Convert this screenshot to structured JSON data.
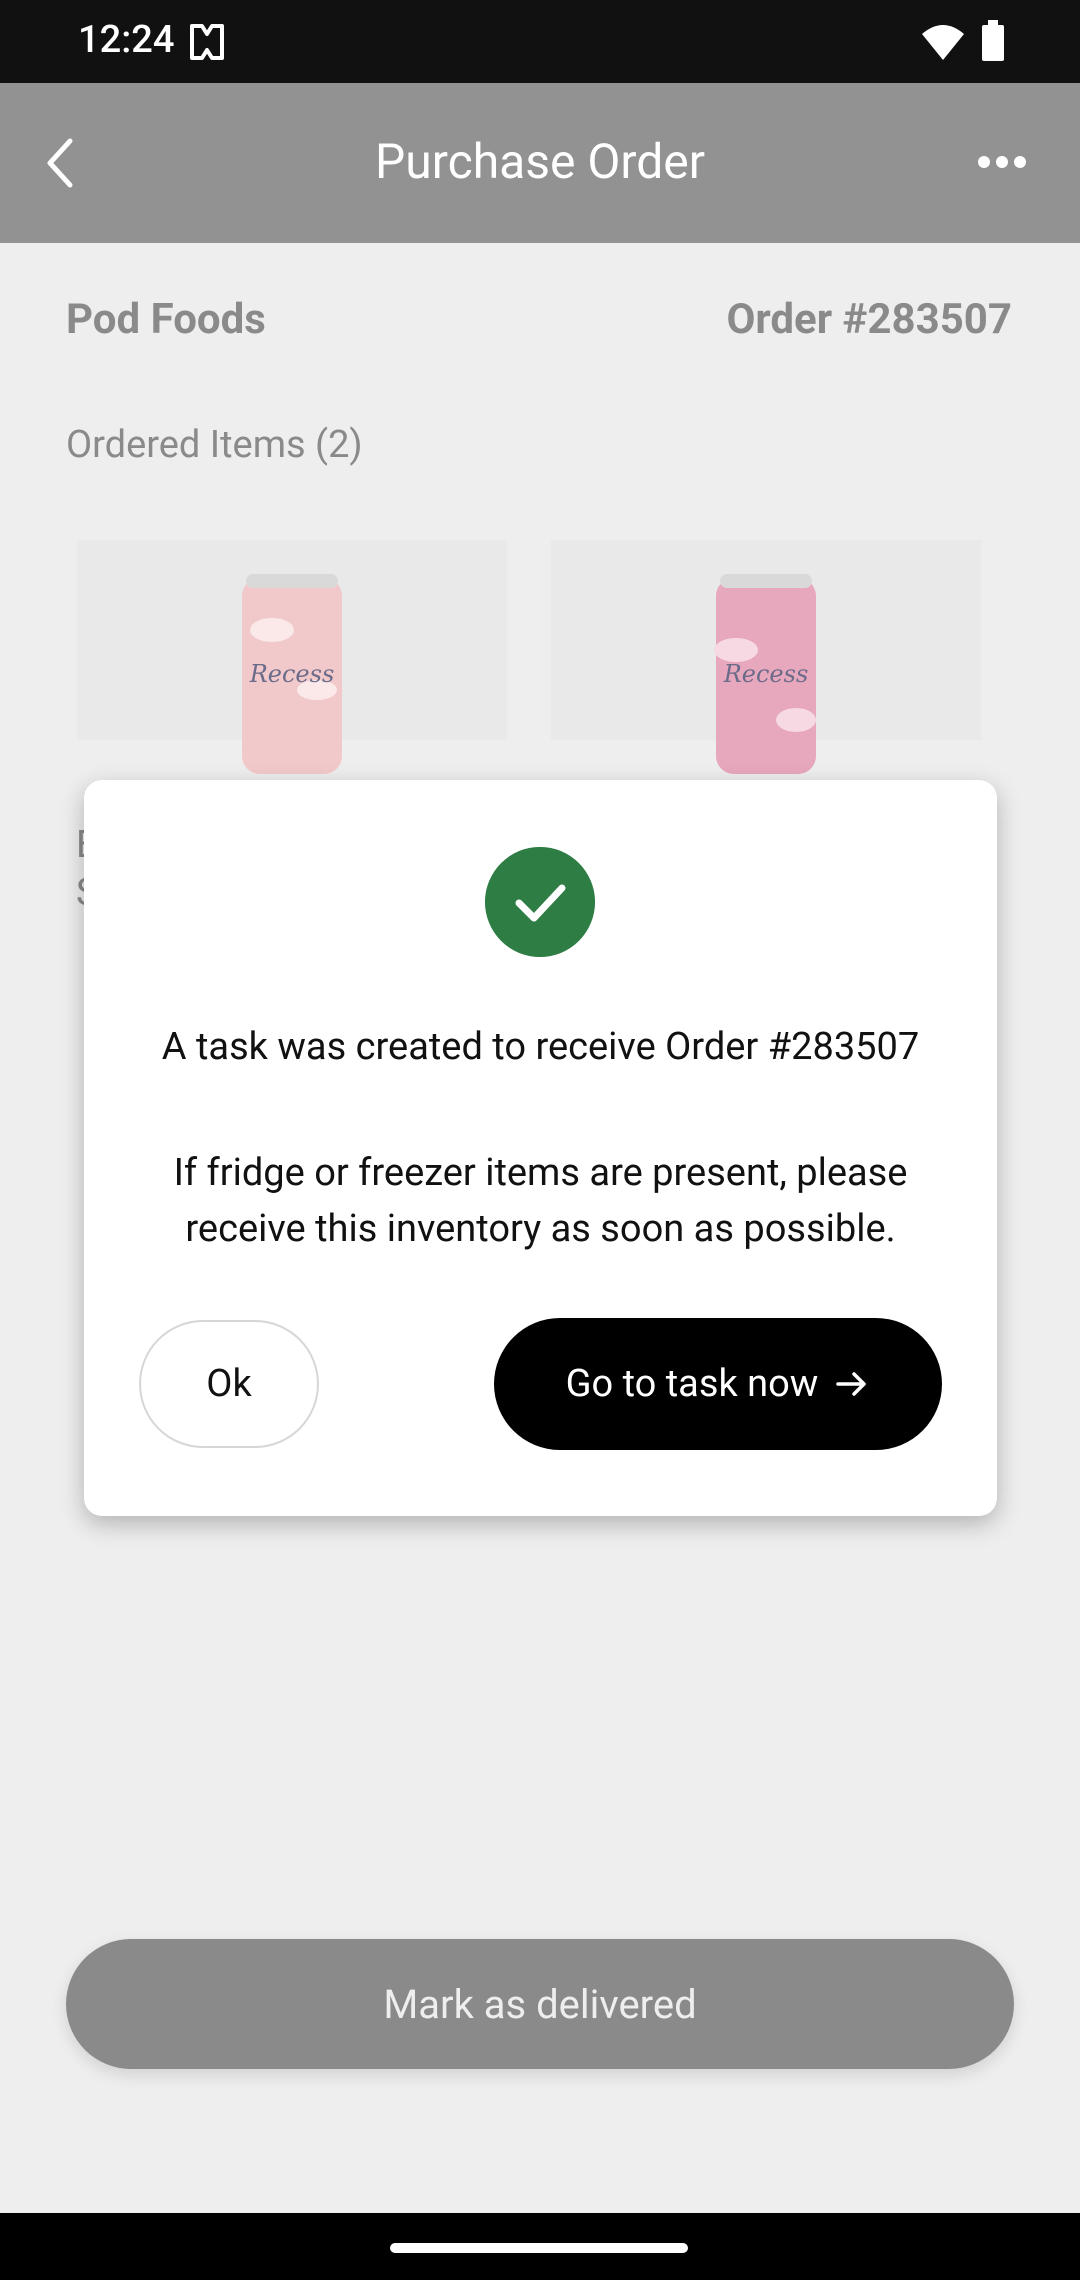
{
  "status_bar": {
    "time": "12:24",
    "icons": [
      "app-notification-icon",
      "wifi-icon",
      "battery-icon"
    ]
  },
  "header": {
    "title": "Purchase Order",
    "back_icon": "back-chevron-icon",
    "more_icon": "more-horizontal-icon"
  },
  "order": {
    "vendor": "Pod Foods",
    "number": "Order #283507",
    "items_label": "Ordered Items (2)",
    "items": [
      {
        "image": "recess-can-pink-light"
      },
      {
        "image": "recess-can-pink-dark"
      }
    ],
    "partial_text_line1": "E",
    "partial_text_line2": "S"
  },
  "primary_action": {
    "label": "Mark as delivered"
  },
  "modal": {
    "icon": "check-circle-icon",
    "accent_color": "#2e7d44",
    "title": "A task was created to receive Order #283507",
    "body": "If fridge or freezer items are present, please receive this inventory as soon as possible.",
    "ok_label": "Ok",
    "go_label": "Go to task now"
  }
}
